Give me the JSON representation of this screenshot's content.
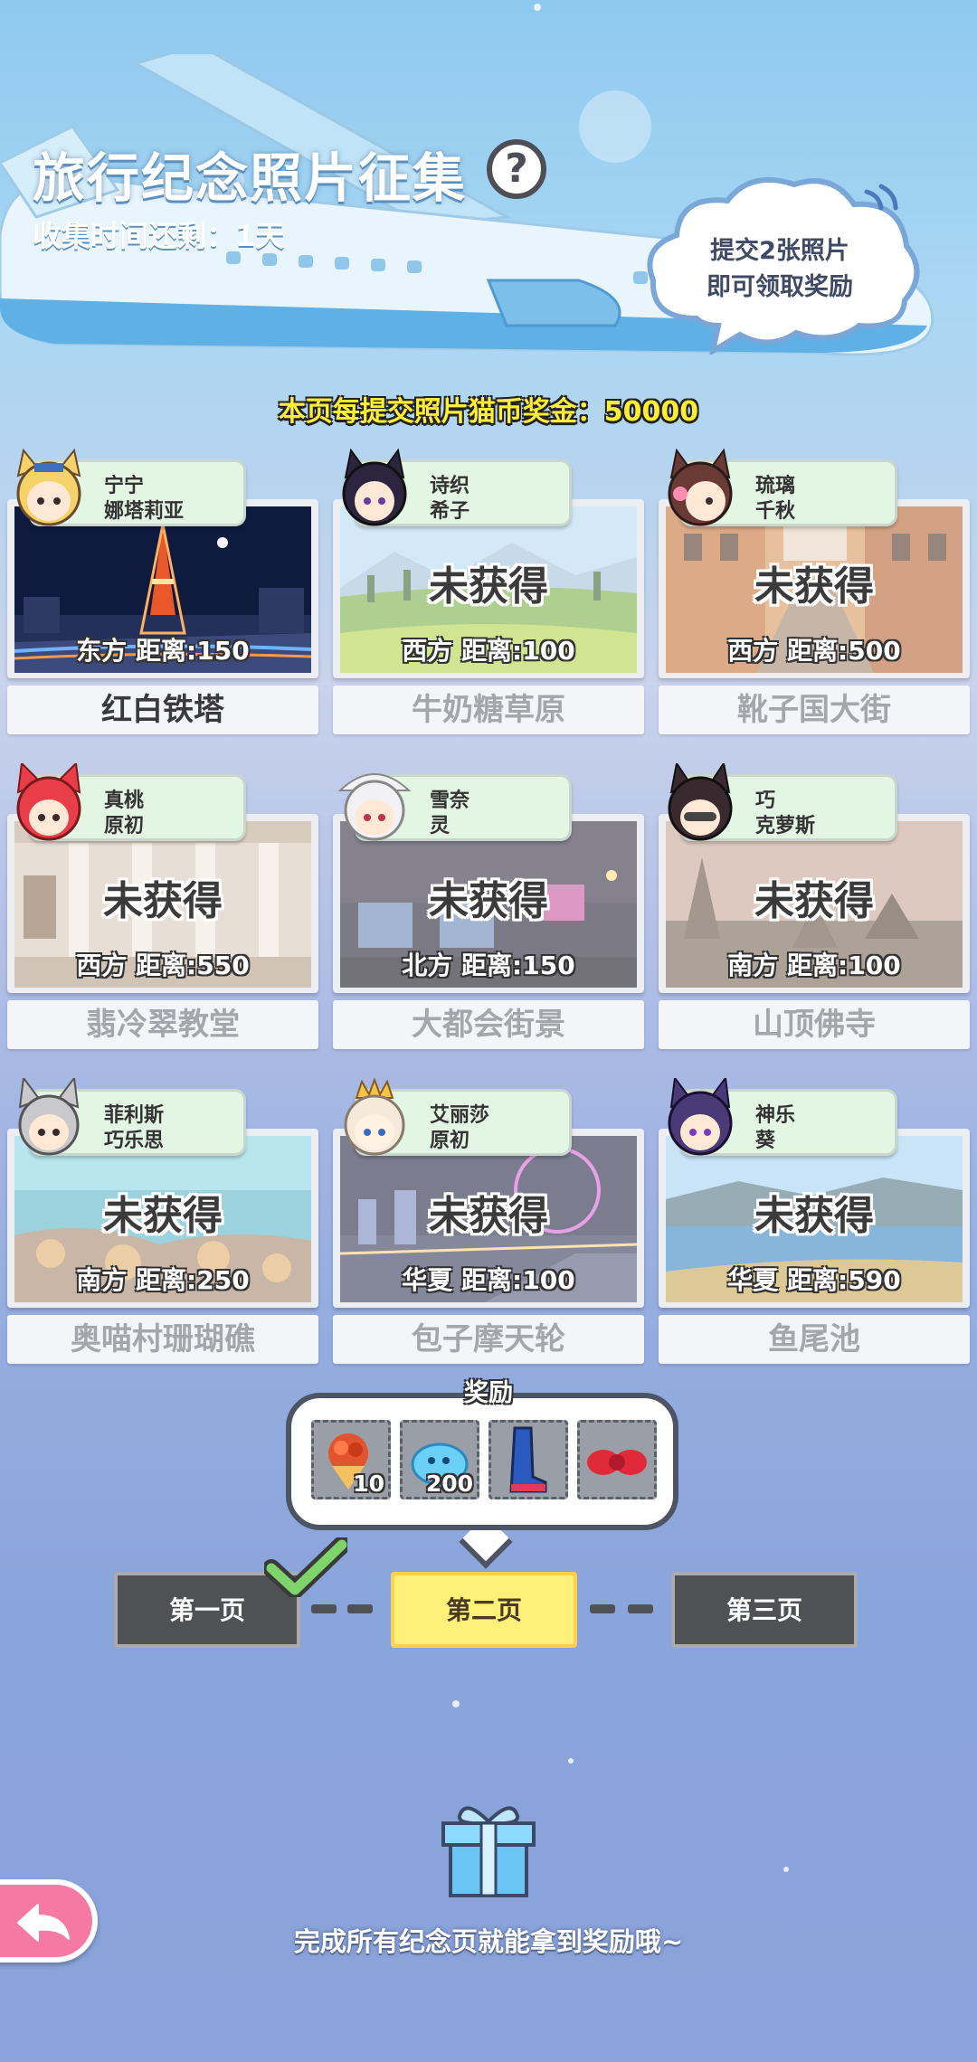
{
  "header": {
    "title": "旅行纪念照片征集",
    "help_symbol": "?",
    "time_remaining": "收集时间还剩：1天"
  },
  "cloud_hint": {
    "line1": "提交2张照片",
    "line2": "即可领取奖励"
  },
  "bonus_text": "本页每提交照片猫币奖金：50000",
  "cards": [
    {
      "char1": "宁宁",
      "char2": "娜塔莉亚",
      "status": "",
      "distance": "东方 距离:150",
      "name": "红白铁塔",
      "obtained": true,
      "hair": "#f5d36a"
    },
    {
      "char1": "诗织",
      "char2": "希子",
      "status": "未获得",
      "distance": "西方 距离:100",
      "name": "牛奶糖草原",
      "obtained": false,
      "hair": "#2b2540"
    },
    {
      "char1": "琉璃",
      "char2": "千秋",
      "status": "未获得",
      "distance": "西方 距离:500",
      "name": "靴子国大街",
      "obtained": false,
      "hair": "#6a3b35"
    },
    {
      "char1": "真桃",
      "char2": "原初",
      "status": "未获得",
      "distance": "西方 距离:550",
      "name": "翡冷翠教堂",
      "obtained": false,
      "hair": "#e83e4a"
    },
    {
      "char1": "雪奈",
      "char2": "灵",
      "status": "未获得",
      "distance": "北方 距离:150",
      "name": "大都会街景",
      "obtained": false,
      "hair": "#f2f2f4"
    },
    {
      "char1": "巧",
      "char2": "克萝斯",
      "status": "未获得",
      "distance": "南方 距离:100",
      "name": "山顶佛寺",
      "obtained": false,
      "hair": "#3a2a30"
    },
    {
      "char1": "菲利斯",
      "char2": "巧乐思",
      "status": "未获得",
      "distance": "南方 距离:250",
      "name": "奥喵村珊瑚礁",
      "obtained": false,
      "hair": "#c9c9cc"
    },
    {
      "char1": "艾丽莎",
      "char2": "原初",
      "status": "未获得",
      "distance": "华夏 距离:100",
      "name": "包子摩天轮",
      "obtained": false,
      "hair": "#f5e9dc"
    },
    {
      "char1": "神乐",
      "char2": "葵",
      "status": "未获得",
      "distance": "华夏 距离:590",
      "name": "鱼尾池",
      "obtained": false,
      "hair": "#4b3a78"
    }
  ],
  "rewards": {
    "label": "奖励",
    "items": [
      {
        "icon": "rose-bouquet-icon",
        "count": "10"
      },
      {
        "icon": "blue-slime-icon",
        "count": "200"
      },
      {
        "icon": "boots-icon",
        "count": ""
      },
      {
        "icon": "red-bow-icon",
        "count": ""
      }
    ]
  },
  "pages": {
    "page1": "第一页",
    "page2": "第二页",
    "page3": "第三页",
    "current": 2,
    "completed": [
      1
    ]
  },
  "footer": {
    "gift_text": "完成所有纪念页就能拿到奖励哦~"
  },
  "colors": {
    "accent_yellow": "#fff07a",
    "dark_button": "#4f5155",
    "back_button": "#f57aa3",
    "check_green": "#7ed36a"
  }
}
